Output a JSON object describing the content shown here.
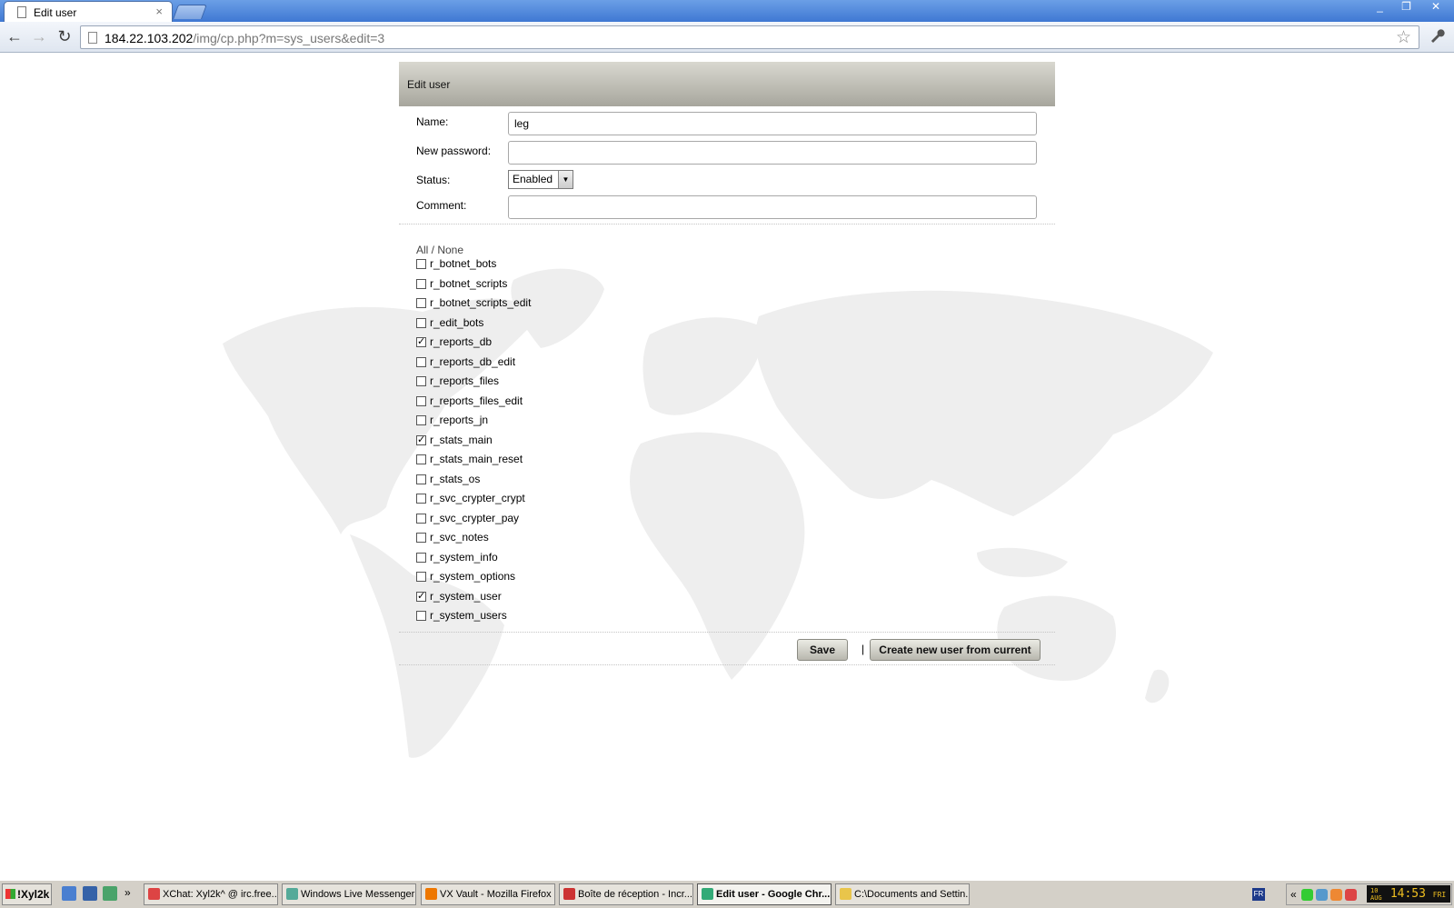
{
  "browser": {
    "tab_title": "Edit user",
    "tab_close": "×",
    "url_host": "184.22.103.202",
    "url_path": "/img/cp.php?m=sys_users&edit=3",
    "window_controls": {
      "minimize": "_",
      "maximize": "❐",
      "close": "✕"
    },
    "nav": {
      "back": "←",
      "forward": "→",
      "reload": "↻",
      "star": "☆",
      "wrench": "🔧"
    }
  },
  "form": {
    "header": "Edit user",
    "name_label": "Name:",
    "name_value": "leg",
    "password_label": "New password:",
    "password_value": "",
    "status_label": "Status:",
    "status_value": "Enabled",
    "comment_label": "Comment:",
    "comment_value": "",
    "all_none": "All / None",
    "permissions": [
      {
        "name": "r_botnet_bots",
        "checked": false
      },
      {
        "name": "r_botnet_scripts",
        "checked": false
      },
      {
        "name": "r_botnet_scripts_edit",
        "checked": false
      },
      {
        "name": "r_edit_bots",
        "checked": false
      },
      {
        "name": "r_reports_db",
        "checked": true
      },
      {
        "name": "r_reports_db_edit",
        "checked": false
      },
      {
        "name": "r_reports_files",
        "checked": false
      },
      {
        "name": "r_reports_files_edit",
        "checked": false
      },
      {
        "name": "r_reports_jn",
        "checked": false
      },
      {
        "name": "r_stats_main",
        "checked": true
      },
      {
        "name": "r_stats_main_reset",
        "checked": false
      },
      {
        "name": "r_stats_os",
        "checked": false
      },
      {
        "name": "r_svc_crypter_crypt",
        "checked": false
      },
      {
        "name": "r_svc_crypter_pay",
        "checked": false
      },
      {
        "name": "r_svc_notes",
        "checked": false
      },
      {
        "name": "r_system_info",
        "checked": false
      },
      {
        "name": "r_system_options",
        "checked": false
      },
      {
        "name": "r_system_user",
        "checked": true
      },
      {
        "name": "r_system_users",
        "checked": false
      }
    ],
    "save_label": "Save",
    "separator": "|",
    "create_label": "Create new user from current"
  },
  "taskbar": {
    "start_label": "!Xyl2k",
    "quicklaunch_more": "»",
    "items": [
      {
        "label": "XChat: Xyl2k^ @ irc.free...",
        "icon": "xchat-icon",
        "color": "#d44"
      },
      {
        "label": "Windows Live Messenger",
        "icon": "messenger-icon",
        "color": "#5a9"
      },
      {
        "label": "VX Vault - Mozilla Firefox",
        "icon": "firefox-icon",
        "color": "#e70"
      },
      {
        "label": "Boîte de réception - Incr...",
        "icon": "mail-icon",
        "color": "#c33"
      },
      {
        "label": "Edit user - Google Chr...",
        "icon": "chrome-icon",
        "color": "#3a7"
      },
      {
        "label": "C:\\Documents and Settin...",
        "icon": "folder-icon",
        "color": "#e9c54b"
      }
    ],
    "lang": "FR",
    "tray_expand": "«",
    "clock_date": "10 AUG",
    "clock_time": "14:53",
    "clock_day": "FRI"
  }
}
